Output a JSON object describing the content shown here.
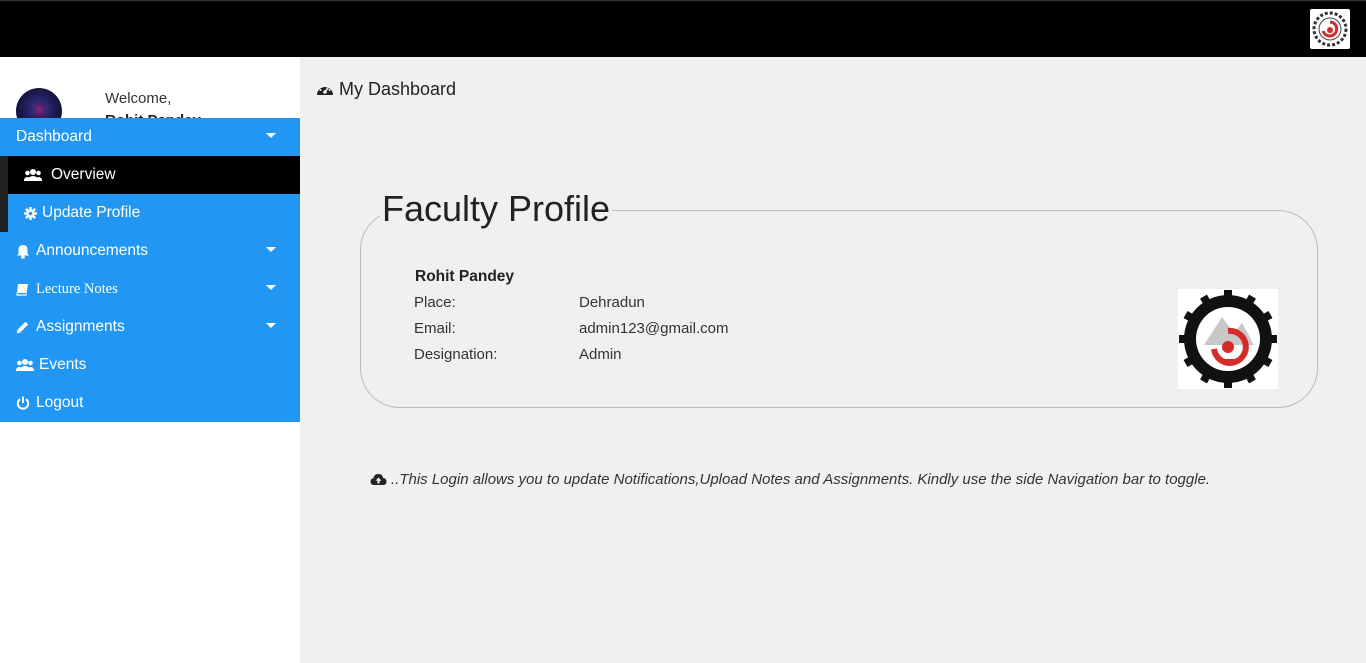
{
  "header": {
    "logo_icon": "university-seal-icon"
  },
  "sidebar": {
    "welcome": "Welcome,",
    "username": "Rohit Pandey",
    "nav": [
      {
        "label": "Dashboard",
        "icon": null,
        "has_caret": true
      },
      {
        "label": "Overview",
        "icon": "users-icon",
        "active": true
      },
      {
        "label": "Update Profile",
        "icon": "gear-icon"
      },
      {
        "label": "Announcements",
        "icon": "bell-icon",
        "has_caret": true
      },
      {
        "label": "Lecture Notes",
        "icon": "book-icon",
        "has_caret": true
      },
      {
        "label": "Assignments",
        "icon": "pencil-icon",
        "has_caret": true
      },
      {
        "label": "Events",
        "icon": "users-icon"
      },
      {
        "label": "Logout",
        "icon": "power-icon"
      }
    ]
  },
  "main": {
    "title": "My Dashboard",
    "profile": {
      "legend": "Faculty Profile",
      "name": "Rohit Pandey",
      "rows": [
        {
          "label": "Place:",
          "value": "Dehradun"
        },
        {
          "label": "Email:",
          "value": "admin123@gmail.com"
        },
        {
          "label": "Designation:",
          "value": "Admin"
        }
      ]
    },
    "note": "..This Login allows you to update Notifications,Upload Notes and Assignments. Kindly use the side Navigation bar to toggle."
  },
  "colors": {
    "accent": "#2196f3",
    "topbar": "#000000",
    "active_bg": "#000000"
  }
}
